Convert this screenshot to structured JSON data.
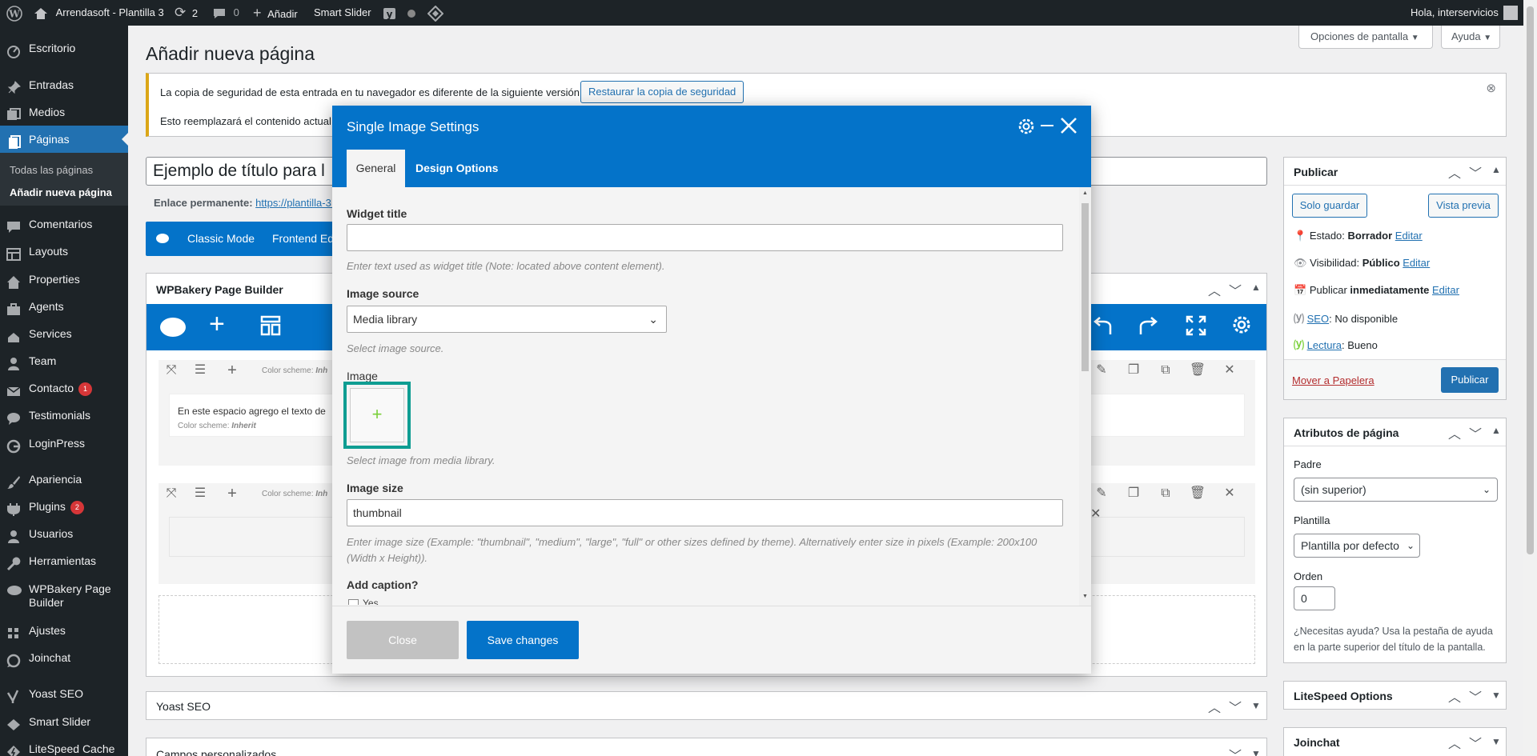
{
  "adminbar": {
    "site": "Arrendasoft - Plantilla 3",
    "updates": "2",
    "comments": "0",
    "add": "Añadir",
    "smart_slider": "Smart Slider",
    "greeting": "Hola, interservicios"
  },
  "sidebar": {
    "items": [
      {
        "label": "Escritorio",
        "icon": "dashboard-icon"
      },
      {
        "label": "Entradas",
        "icon": "pin-icon"
      },
      {
        "label": "Medios",
        "icon": "media-icon"
      },
      {
        "label": "Páginas",
        "icon": "pages-icon"
      },
      {
        "label": "Comentarios",
        "icon": "comment-icon"
      },
      {
        "label": "Layouts",
        "icon": "layouts-icon"
      },
      {
        "label": "Properties",
        "icon": "home-icon"
      },
      {
        "label": "Agents",
        "icon": "agents-icon"
      },
      {
        "label": "Services",
        "icon": "services-icon"
      },
      {
        "label": "Team",
        "icon": "team-icon"
      },
      {
        "label": "Contacto",
        "icon": "mail-icon",
        "badge": "1"
      },
      {
        "label": "Testimonials",
        "icon": "testimonial-icon"
      },
      {
        "label": "LoginPress",
        "icon": "loginpress-icon"
      },
      {
        "label": "Apariencia",
        "icon": "brush-icon"
      },
      {
        "label": "Plugins",
        "icon": "plugin-icon",
        "badge": "2"
      },
      {
        "label": "Usuarios",
        "icon": "user-icon"
      },
      {
        "label": "Herramientas",
        "icon": "tools-icon"
      },
      {
        "label": "WPBakery Page",
        "label2": "Builder",
        "icon": "wpbakery-icon"
      },
      {
        "label": "Ajustes",
        "icon": "settings-icon"
      },
      {
        "label": "Joinchat",
        "icon": "chat-icon"
      },
      {
        "label": "Yoast SEO",
        "icon": "yoast-icon"
      },
      {
        "label": "Smart Slider",
        "icon": "slider-icon"
      },
      {
        "label": "LiteSpeed Cache",
        "icon": "litespeed-icon"
      }
    ],
    "sub": {
      "all_pages": "Todas las páginas",
      "add_new": "Añadir nueva página"
    }
  },
  "screen_options": "Opciones de pantalla",
  "help": "Ayuda",
  "page_title": "Añadir nueva página",
  "notice": {
    "line1": "La copia de seguridad de esta entrada en tu navegador es diferente de la siguiente versión.",
    "restore": "Restaurar la copia de seguridad",
    "line2": "Esto reemplazará el contenido actual"
  },
  "post_title": "Ejemplo de título para l",
  "permalink": {
    "label": "Enlace permanente:",
    "url": "https://plantilla-3."
  },
  "modes": {
    "classic": "Classic Mode",
    "frontend": "Frontend Ed"
  },
  "wpb": {
    "title": "WPBakery Page Builder",
    "color_scheme": "Color scheme:",
    "inherit": "Inherit",
    "text_block": "En este espacio agrego el texto de",
    "inh_short": "Inh"
  },
  "yoast_box": "Yoast SEO",
  "custom_fields": "Campos personalizados",
  "publish": {
    "title": "Publicar",
    "save": "Solo guardar",
    "preview": "Vista previa",
    "status": "Estado:",
    "status_val": "Borrador",
    "edit": "Editar",
    "visibility": "Visibilidad:",
    "visibility_val": "Público",
    "publish_now": "Publicar",
    "now": "inmediatamente",
    "seo": "SEO",
    "seo_val": ": No disponible",
    "reading": "Lectura",
    "reading_val": ": Bueno",
    "trash": "Mover a Papelera",
    "publish_btn": "Publicar"
  },
  "attrs": {
    "title": "Atributos de página",
    "parent": "Padre",
    "parent_val": "(sin superior)",
    "template": "Plantilla",
    "template_val": "Plantilla por defecto",
    "order": "Orden",
    "order_val": "0",
    "help": "¿Necesitas ayuda? Usa la pestaña de ayuda en la parte superior del título de la pantalla."
  },
  "litespeed_box": "LiteSpeed Options",
  "joinchat_box": "Joinchat",
  "modal": {
    "title": "Single Image Settings",
    "tabs": [
      "General",
      "Design Options"
    ],
    "widget_title_label": "Widget title",
    "widget_title_value": "",
    "widget_title_help": "Enter text used as widget title (Note: located above content element).",
    "source_label": "Image source",
    "source_value": "Media library",
    "source_help": "Select image source.",
    "image_label": "Image",
    "image_help": "Select image from media library.",
    "size_label": "Image size",
    "size_value": "thumbnail",
    "size_help": "Enter image size (Example: \"thumbnail\", \"medium\", \"large\", \"full\" or other sizes defined by theme). Alternatively enter size in pixels (Example: 200x100 (Width x Height)).",
    "caption_label": "Add caption?",
    "caption_option": "Yes",
    "close": "Close",
    "save": "Save changes"
  },
  "colors": {
    "admin_dark": "#1d2327",
    "wp_blue": "#2271b1",
    "vc_blue": "#0473c9",
    "highlight": "#0f9d92"
  }
}
